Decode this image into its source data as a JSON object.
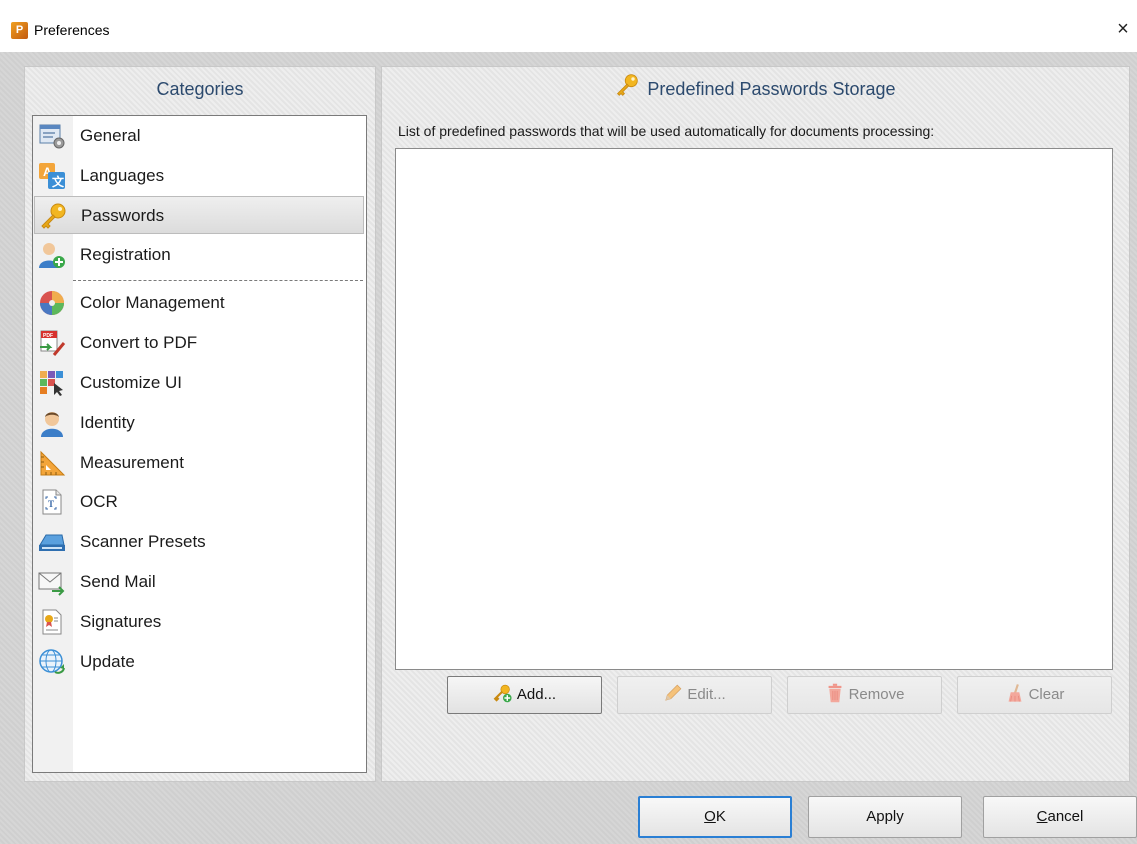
{
  "window": {
    "title": "Preferences",
    "app_icon_glyph": "P",
    "close_glyph": "×"
  },
  "categories": {
    "header": "Categories",
    "items": [
      {
        "label": "General",
        "icon": "general-settings-icon",
        "selected": false
      },
      {
        "label": "Languages",
        "icon": "languages-icon",
        "selected": false
      },
      {
        "label": "Passwords",
        "icon": "key-icon",
        "selected": true
      },
      {
        "label": "Registration",
        "icon": "registration-icon",
        "selected": false
      },
      {
        "label": "Color Management",
        "icon": "color-wheel-icon",
        "selected": false
      },
      {
        "label": "Convert to PDF",
        "icon": "convert-pdf-icon",
        "selected": false
      },
      {
        "label": "Customize UI",
        "icon": "customize-ui-icon",
        "selected": false
      },
      {
        "label": "Identity",
        "icon": "identity-icon",
        "selected": false
      },
      {
        "label": "Measurement",
        "icon": "ruler-icon",
        "selected": false
      },
      {
        "label": "OCR",
        "icon": "ocr-icon",
        "selected": false
      },
      {
        "label": "Scanner Presets",
        "icon": "scanner-icon",
        "selected": false
      },
      {
        "label": "Send Mail",
        "icon": "mail-icon",
        "selected": false
      },
      {
        "label": "Signatures",
        "icon": "signature-icon",
        "selected": false
      },
      {
        "label": "Update",
        "icon": "update-globe-icon",
        "selected": false
      }
    ]
  },
  "main": {
    "header": "Predefined Passwords Storage",
    "description": "List of predefined passwords that will be used automatically for documents processing:",
    "passwords": [],
    "buttons": {
      "add": "Add...",
      "edit": "Edit...",
      "remove": "Remove",
      "clear": "Clear"
    }
  },
  "footer": {
    "ok_prefix": "O",
    "ok_rest": "K",
    "apply": "Apply",
    "cancel_prefix": "C",
    "cancel_rest": "ancel"
  },
  "colors": {
    "header_text": "#2c4a6e",
    "default_button_border": "#2a7fd4"
  }
}
